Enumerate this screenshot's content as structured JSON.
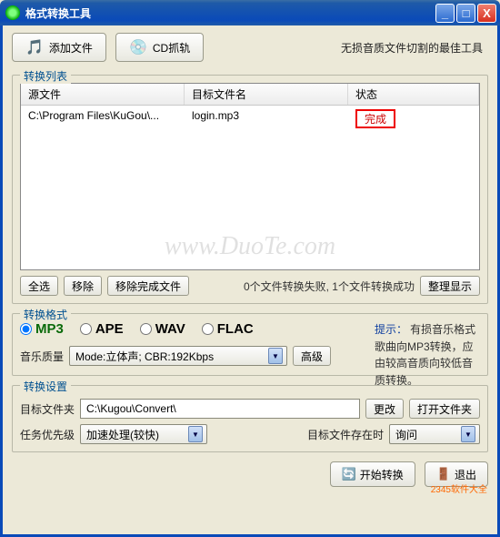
{
  "window": {
    "title": "格式转换工具",
    "tagline": "无损音质文件切割的最佳工具"
  },
  "toolbar": {
    "add_file": "添加文件",
    "cd_rip": "CD抓轨"
  },
  "list": {
    "legend": "转换列表",
    "cols": {
      "source": "源文件",
      "target": "目标文件名",
      "status": "状态"
    },
    "rows": [
      {
        "source": "C:\\Program Files\\KuGou\\...",
        "target": "login.mp3",
        "status": "完成"
      }
    ],
    "buttons": {
      "select_all": "全选",
      "remove": "移除",
      "remove_done": "移除完成文件",
      "tidy": "整理显示"
    },
    "summary": "0个文件转换失败, 1个文件转换成功"
  },
  "format": {
    "legend": "转换格式",
    "options": [
      "MP3",
      "APE",
      "WAV",
      "FLAC"
    ],
    "selected": "MP3",
    "tip_label": "提示：",
    "tip_text": "有损音乐格式歌曲向MP3转换，应由较高音质向较低音质转换。",
    "quality_label": "音乐质量",
    "quality_value": "Mode:立体声; CBR:192Kbps",
    "advanced": "高级"
  },
  "settings": {
    "legend": "转换设置",
    "target_folder_label": "目标文件夹",
    "target_folder_value": "C:\\Kugou\\Convert\\",
    "change": "更改",
    "open_folder": "打开文件夹",
    "priority_label": "任务优先级",
    "priority_value": "加速处理(较快)",
    "exists_label": "目标文件存在时",
    "exists_value": "询问"
  },
  "bottom": {
    "start": "开始转换",
    "exit": "退出"
  },
  "watermark": "www.DuoTe.com",
  "corner": "2345软件大全"
}
